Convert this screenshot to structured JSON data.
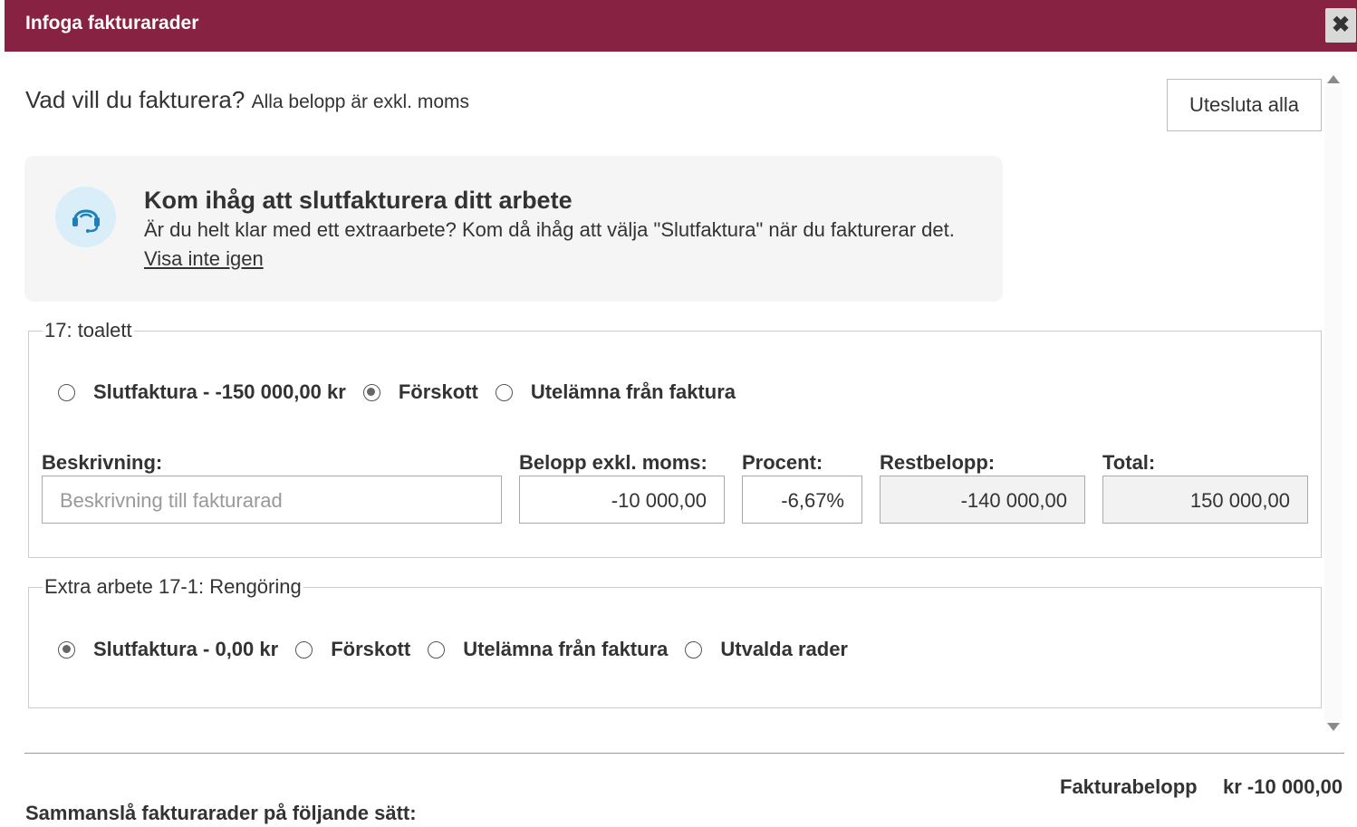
{
  "dialog": {
    "title": "Infoga fakturarader",
    "close_symbol": "✖"
  },
  "header": {
    "question": "Vad vill du fakturera?",
    "note": "Alla belopp är exkl. moms",
    "exclude_all_label": "Utesluta alla"
  },
  "info": {
    "icon": "headset-icon",
    "title": "Kom ihåg att slutfakturera ditt arbete",
    "text": "Är du helt klar med ett extraarbete? Kom då ihåg att välja \"Slutfaktura\" när du fakturerar det.",
    "link": "Visa inte igen"
  },
  "groups": [
    {
      "legend": "17: toalett",
      "options": [
        {
          "label": "Slutfaktura - -150 000,00 kr",
          "checked": false
        },
        {
          "label": "Förskott",
          "checked": true
        },
        {
          "label": "Utelämna från faktura",
          "checked": false
        }
      ],
      "fields": {
        "description": {
          "label": "Beskrivning:",
          "placeholder": "Beskrivning till fakturarad",
          "value": ""
        },
        "amount": {
          "label": "Belopp exkl. moms:",
          "value": "-10 000,00"
        },
        "percent": {
          "label": "Procent:",
          "value": "-6,67%"
        },
        "remaining": {
          "label": "Restbelopp:",
          "value": "-140 000,00"
        },
        "total": {
          "label": "Total:",
          "value": "150 000,00"
        }
      }
    },
    {
      "legend": "Extra arbete 17-1: Rengöring",
      "options": [
        {
          "label": "Slutfaktura - 0,00 kr",
          "checked": true
        },
        {
          "label": "Förskott",
          "checked": false
        },
        {
          "label": "Utelämna från faktura",
          "checked": false
        },
        {
          "label": "Utvalda rader",
          "checked": false
        }
      ]
    }
  ],
  "footer": {
    "invoice_amount_label": "Fakturabelopp",
    "invoice_amount_value": "kr -10 000,00",
    "merge_label": "Sammanslå fakturarader på följande sätt:"
  },
  "colors": {
    "titlebar": "#872242",
    "info_bg": "#f5f5f5",
    "icon_bg": "#d9eef9",
    "icon_stroke": "#1f7fb8"
  }
}
